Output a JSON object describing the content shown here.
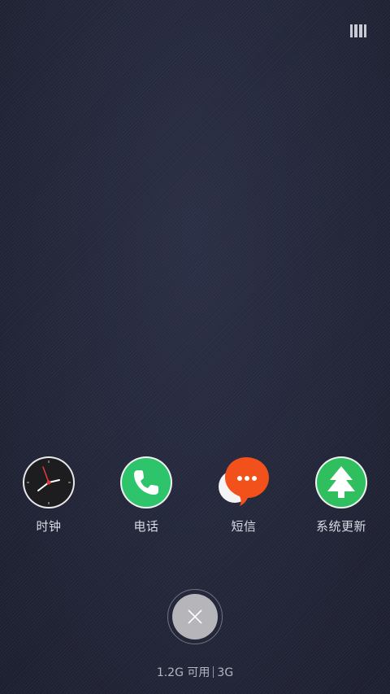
{
  "top_bar": {
    "view_toggle_icon": "grid-view-icon"
  },
  "apps": [
    {
      "label": "时钟",
      "icon": "clock-icon",
      "color": "#222222"
    },
    {
      "label": "电话",
      "icon": "phone-icon",
      "color": "#2ec46b"
    },
    {
      "label": "短信",
      "icon": "message-icon",
      "color": "#f2511b"
    },
    {
      "label": "系统更新",
      "icon": "update-arrow-icon",
      "color": "#2fbf5f"
    }
  ],
  "clear_button": {
    "icon": "close-icon"
  },
  "memory": {
    "available": "1.2G 可用",
    "total": "3G"
  }
}
